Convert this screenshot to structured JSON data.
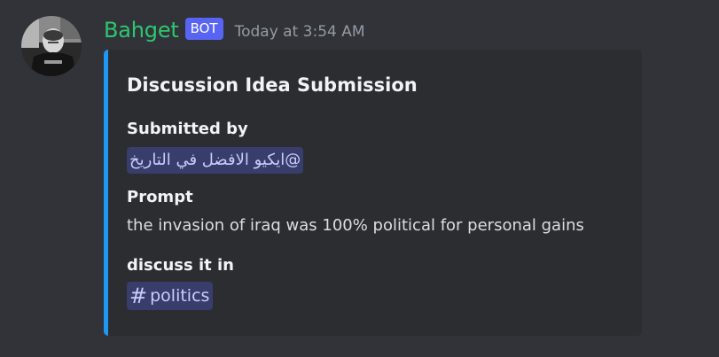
{
  "message": {
    "author": "Bahget",
    "bot_tag": "BOT",
    "timestamp": "Today at 3:54 AM",
    "avatar_icon": "profile-photo"
  },
  "embed": {
    "accent_color": "#1d98f4",
    "title": "Discussion Idea Submission",
    "fields": [
      {
        "name": "Submitted by",
        "value": "@ايكيو الافضل في التاريخ",
        "type": "user-mention"
      },
      {
        "name": "Prompt",
        "value": "the invasion of iraq was 100% political for personal gains",
        "type": "text"
      },
      {
        "name": "discuss it in",
        "value": "politics",
        "type": "channel-mention",
        "icon": "hash-icon"
      }
    ]
  },
  "colors": {
    "background": "#313338",
    "embed_background": "#2b2d31",
    "username": "#2dc770",
    "bot_tag": "#5865f2",
    "mention_text": "#c9cdfb"
  }
}
